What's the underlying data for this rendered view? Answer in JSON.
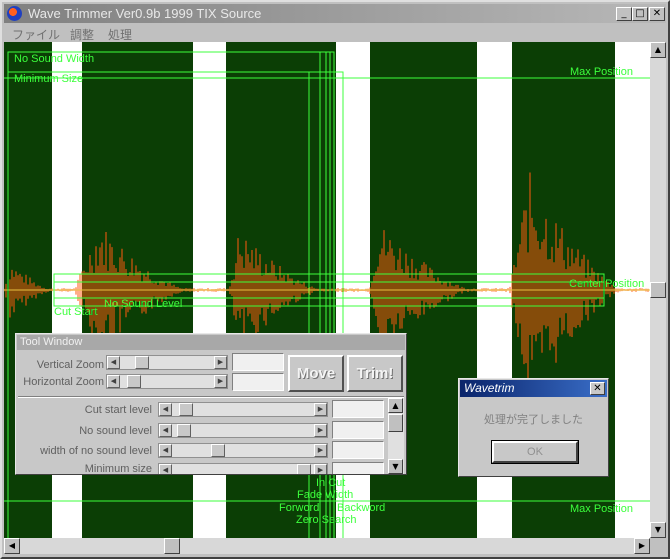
{
  "window": {
    "title": "Wave Trimmer Ver0.9b 1999 TIX Source",
    "minimize_glyph": "_",
    "maximize_glyph": "□",
    "close_glyph": "✕"
  },
  "menu": {
    "items": [
      "ファイル",
      "調整",
      "処理"
    ]
  },
  "canvas": {
    "labels": {
      "no_sound_width": "No Sound Width",
      "minimum_size": "Minimum Size",
      "max_position_top": "Max Position",
      "center_position": "Center Position",
      "cut_start": "Cut Start",
      "no_sound_level": "No Sound Level",
      "max_position_bottom": "Max Position",
      "in_cut": "In Cut",
      "fade_width": "Fade Width",
      "forword": "Forword",
      "backword": "Backword",
      "zero_search": "Zero Search"
    },
    "colors": {
      "background": "#0b3e05",
      "stripe": "#ffffff",
      "wave": "#ff5a10",
      "marker": "#3cff3c",
      "center": "#e8c040"
    }
  },
  "tool_window": {
    "title": "Tool Window",
    "vertical_zoom_label": "Vertical Zoom",
    "horizontal_zoom_label": "Horizontal Zoom",
    "move_button": "Move",
    "trim_button": "Trim!",
    "cut_start_level_label": "Cut start level",
    "no_sound_level_label": "No sound level",
    "width_no_sound_label": "width of no sound level",
    "minimum_size_label": "Minimum size"
  },
  "dialog": {
    "title": "Wavetrim",
    "message": "処理が完了しました",
    "ok_button": "OK",
    "close_glyph": "✕"
  },
  "scroll": {
    "up": "▲",
    "down": "▼",
    "left": "◀",
    "right": "▶"
  }
}
